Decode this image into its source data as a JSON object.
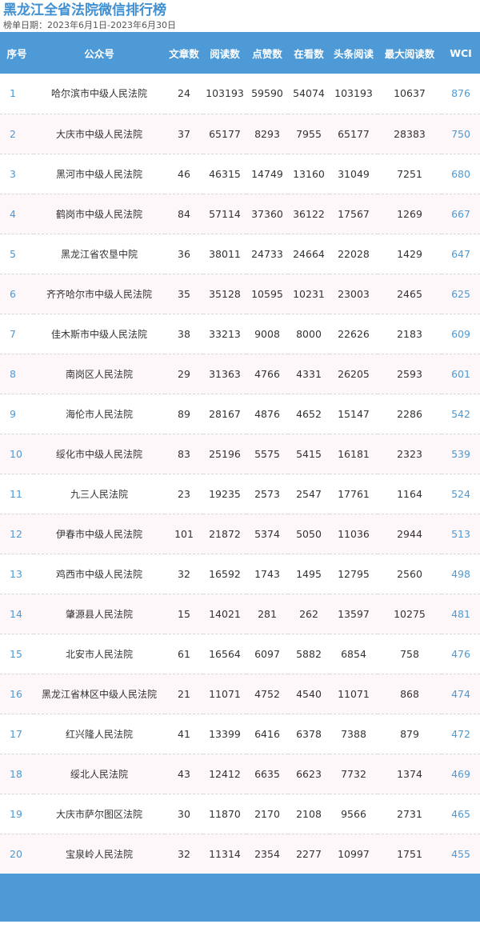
{
  "title": "黑龙江全省法院微信排行榜",
  "date_range": "榜单日期：2023年6月1日-2023年6月30日",
  "colors": {
    "header_bg": "#4d9ad6",
    "title": "#3f8fd1",
    "link": "#4d9ad6"
  },
  "columns": [
    "序号",
    "公众号",
    "文章数",
    "阅读数",
    "点赞数",
    "在看数",
    "头条阅读",
    "最大阅读数",
    "WCI"
  ],
  "rows": [
    [
      "1",
      "哈尔滨市中级人民法院",
      "24",
      "103193",
      "59590",
      "54074",
      "103193",
      "10637",
      "876"
    ],
    [
      "2",
      "大庆市中级人民法院",
      "37",
      "65177",
      "8293",
      "7955",
      "65177",
      "28383",
      "750"
    ],
    [
      "3",
      "黑河市中级人民法院",
      "46",
      "46315",
      "14749",
      "13160",
      "31049",
      "7251",
      "680"
    ],
    [
      "4",
      "鹤岗市中级人民法院",
      "84",
      "57114",
      "37360",
      "36122",
      "17567",
      "1269",
      "667"
    ],
    [
      "5",
      "黑龙江省农垦中院",
      "36",
      "38011",
      "24733",
      "24664",
      "22028",
      "1429",
      "647"
    ],
    [
      "6",
      "齐齐哈尔市中级人民法院",
      "35",
      "35128",
      "10595",
      "10231",
      "23003",
      "2465",
      "625"
    ],
    [
      "7",
      "佳木斯市中级人民法院",
      "38",
      "33213",
      "9008",
      "8000",
      "22626",
      "2183",
      "609"
    ],
    [
      "8",
      "南岗区人民法院",
      "29",
      "31363",
      "4766",
      "4331",
      "26205",
      "2593",
      "601"
    ],
    [
      "9",
      "海伦市人民法院",
      "89",
      "28167",
      "4876",
      "4652",
      "15147",
      "2286",
      "542"
    ],
    [
      "10",
      "绥化市中级人民法院",
      "83",
      "25196",
      "5575",
      "5415",
      "16181",
      "2323",
      "539"
    ],
    [
      "11",
      "九三人民法院",
      "23",
      "19235",
      "2573",
      "2547",
      "17761",
      "1164",
      "524"
    ],
    [
      "12",
      "伊春市中级人民法院",
      "101",
      "21872",
      "5374",
      "5050",
      "11036",
      "2944",
      "513"
    ],
    [
      "13",
      "鸡西市中级人民法院",
      "32",
      "16592",
      "1743",
      "1495",
      "12795",
      "2560",
      "498"
    ],
    [
      "14",
      "肇源县人民法院",
      "15",
      "14021",
      "281",
      "262",
      "13597",
      "10275",
      "481"
    ],
    [
      "15",
      "北安市人民法院",
      "61",
      "16564",
      "6097",
      "5882",
      "6854",
      "758",
      "476"
    ],
    [
      "16",
      "黑龙江省林区中级人民法院",
      "21",
      "11071",
      "4752",
      "4540",
      "11071",
      "868",
      "474"
    ],
    [
      "17",
      "红兴隆人民法院",
      "41",
      "13399",
      "6416",
      "6378",
      "7388",
      "879",
      "472"
    ],
    [
      "18",
      "绥北人民法院",
      "43",
      "12412",
      "6635",
      "6623",
      "7732",
      "1374",
      "469"
    ],
    [
      "19",
      "大庆市萨尔图区法院",
      "30",
      "11870",
      "2170",
      "2108",
      "9566",
      "2731",
      "465"
    ],
    [
      "20",
      "宝泉岭人民法院",
      "32",
      "11314",
      "2354",
      "2277",
      "10997",
      "1751",
      "455"
    ]
  ]
}
